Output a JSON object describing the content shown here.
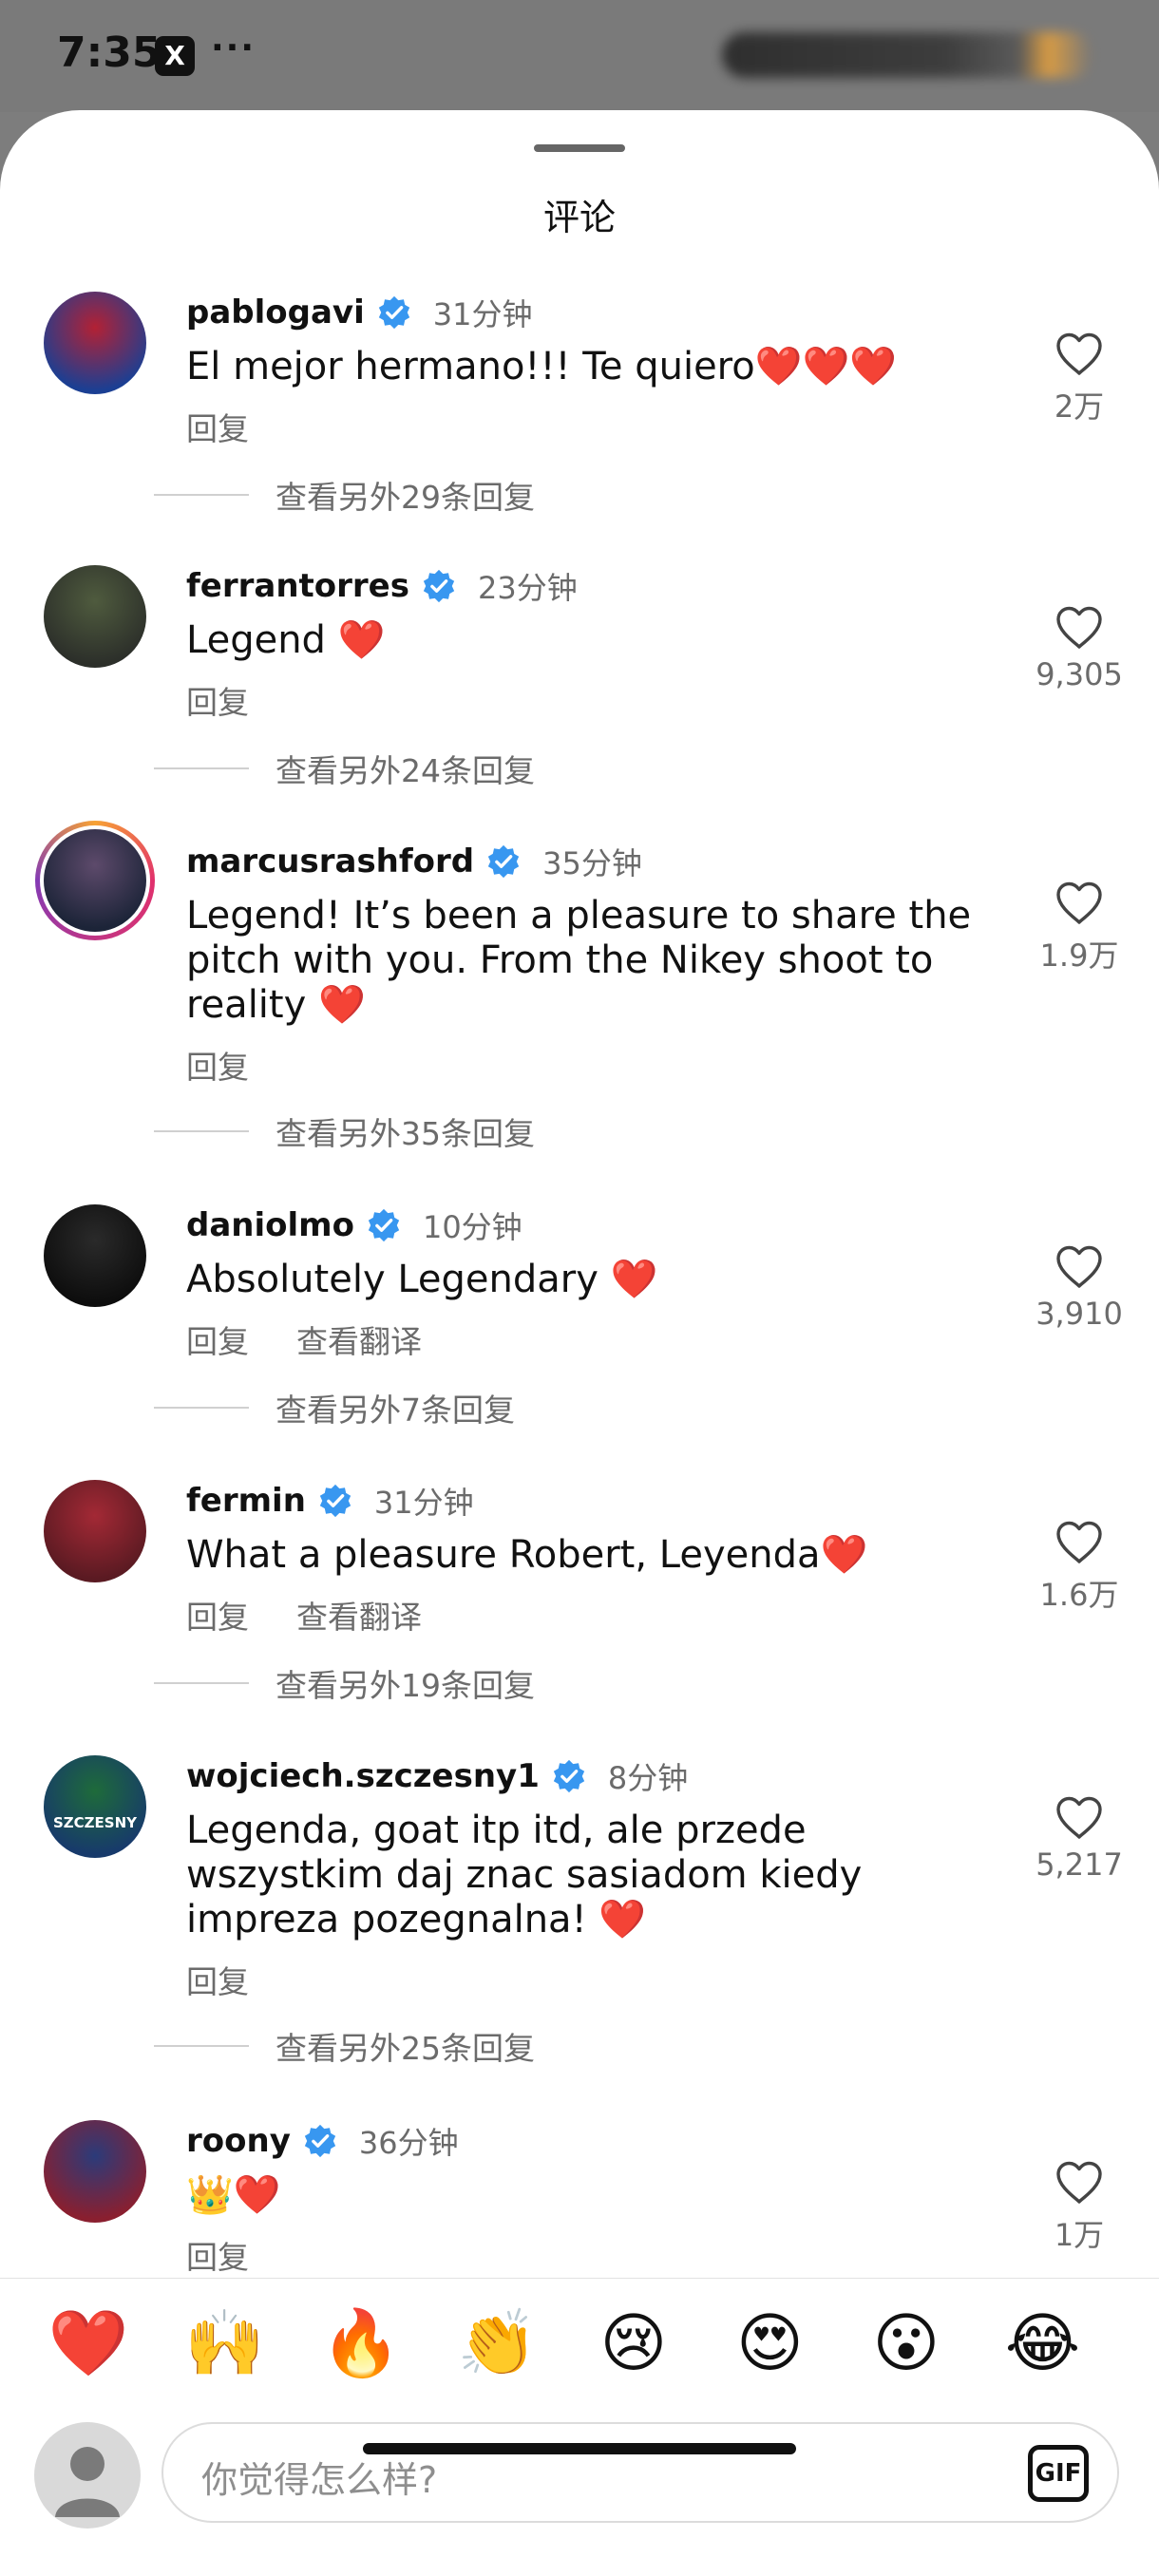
{
  "status_bar": {
    "time": "7:35",
    "app_badge": "X",
    "more": "···"
  },
  "sheet": {
    "title": "评论"
  },
  "comments": [
    {
      "username": "pablogavi",
      "time": "31分钟",
      "text": "El mejor hermano!!! Te quiero❤️❤️❤️",
      "reply": "回复",
      "likes": "2万",
      "view_more": "查看另外29条回复",
      "avatar_colors": [
        "#b32134",
        "#1b3f93"
      ]
    },
    {
      "username": "ferrantorres",
      "time": "23分钟",
      "text": "Legend ❤️",
      "reply": "回复",
      "likes": "9,305",
      "view_more": "查看另外24条回复",
      "avatar_colors": [
        "#4f5b3e",
        "#2c2f2a"
      ]
    },
    {
      "username": "marcusrashford",
      "time": "35分钟",
      "text": "Legend! It’s been a pleasure to share the pitch with you. From the Nikey shoot to reality ❤️",
      "reply": "回复",
      "likes": "1.9万",
      "view_more": "查看另外35条回复",
      "avatar_colors": [
        "#5d4a6b",
        "#1c2438"
      ],
      "story_ring": true
    },
    {
      "username": "daniolmo",
      "time": "10分钟",
      "text": "Absolutely Legendary ❤️",
      "reply": "回复",
      "translate": "查看翻译",
      "likes": "3,910",
      "view_more": "查看另外7条回复",
      "avatar_colors": [
        "#2a2a2a",
        "#0d0d0d"
      ]
    },
    {
      "username": "fermin",
      "time": "31分钟",
      "text": "What a pleasure Robert, Leyenda❤️",
      "reply": "回复",
      "translate": "查看翻译",
      "likes": "1.6万",
      "view_more": "查看另外19条回复",
      "avatar_colors": [
        "#a32935",
        "#5a1a22"
      ]
    },
    {
      "username": "wojciech.szczesny1",
      "time": "8分钟",
      "text": "Legenda, goat itp itd, ale przede wszystkim daj znac sasiadom kiedy impreza pozegnalna! ❤️",
      "reply": "回复",
      "likes": "5,217",
      "view_more": "查看另外25条回复",
      "avatar_colors": [
        "#1e6b3a",
        "#173a6b"
      ],
      "avatar_caption": "SZCZESNY"
    },
    {
      "username": "roony",
      "time": "36分钟",
      "text": "👑❤️",
      "reply": "回复",
      "likes": "1万",
      "avatar_colors": [
        "#2b3b7a",
        "#8a1f2f"
      ]
    }
  ],
  "reactions": [
    "❤️",
    "🙌",
    "🔥",
    "👏",
    "😢",
    "😍",
    "😮",
    "😂"
  ],
  "composer": {
    "placeholder": "你觉得怎么样?",
    "gif_label": "GIF"
  },
  "colors": {
    "secondary_text": "#6b6b6b",
    "verified_blue": "#3897f0",
    "sheet_bg": "#ffffff",
    "scrim": "#7d7d7d"
  },
  "icons": {
    "verified": "verified-badge-icon",
    "like": "heart-outline-icon",
    "gif": "gif-icon",
    "avatar_placeholder": "default-avatar-icon"
  }
}
